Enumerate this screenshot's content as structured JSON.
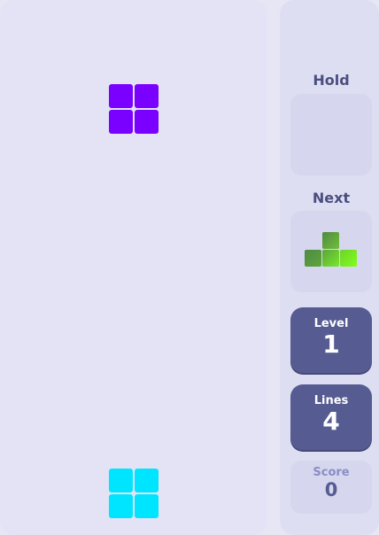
{
  "colors": {
    "o_piece": "#7a00ff",
    "i_piece": "#00e5ff",
    "t_piece_dark": "#4f8a44",
    "t_piece_light": "#7dff1a",
    "panel_dark": "#565c91"
  },
  "hold": {
    "label": "Hold"
  },
  "next": {
    "label": "Next",
    "piece": "T"
  },
  "stats": {
    "level": {
      "label": "Level",
      "value": "1"
    },
    "lines": {
      "label": "Lines",
      "value": "4"
    },
    "score": {
      "label": "Score",
      "value": "0"
    }
  }
}
